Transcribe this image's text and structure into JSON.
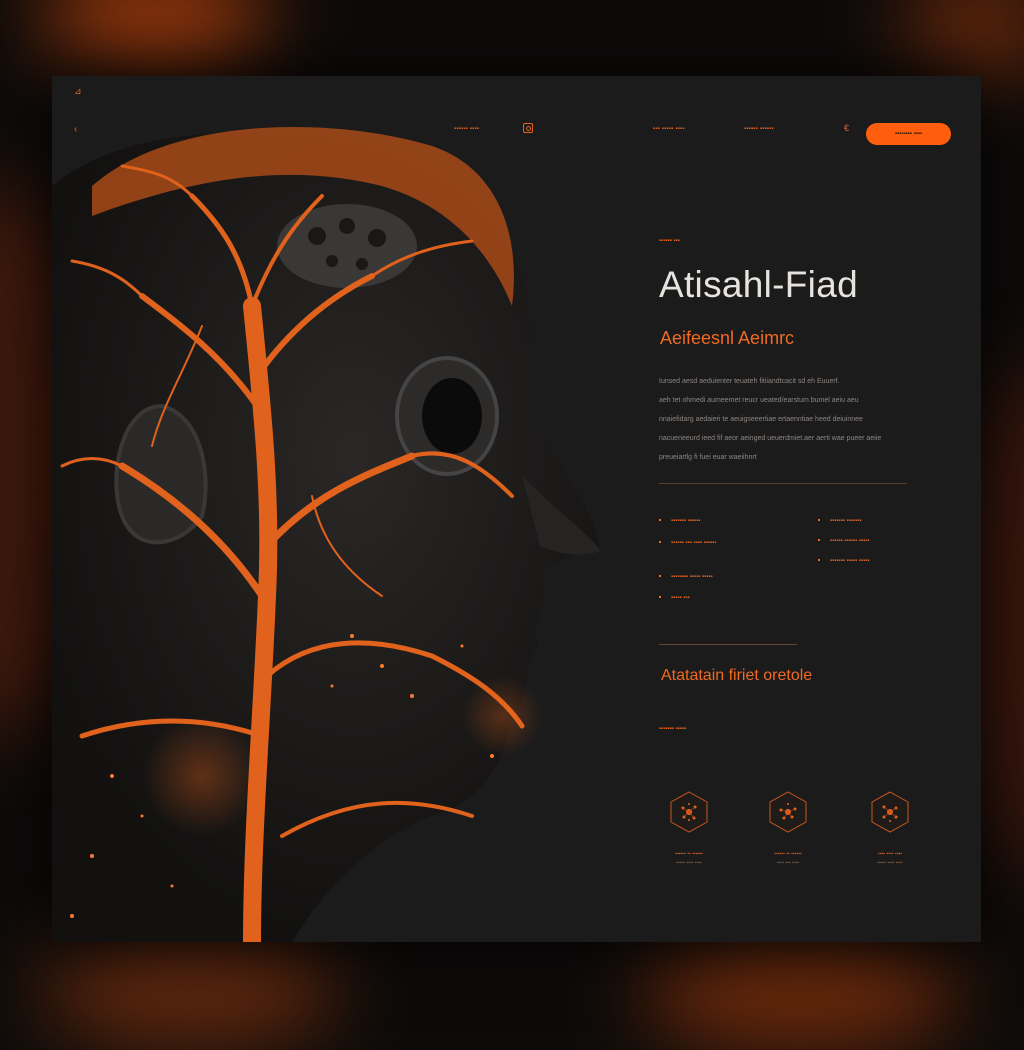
{
  "header": {
    "logo_mark": "⊿",
    "back_icon": "‹",
    "nav": {
      "link1": "▪▪▪▪▪▪ ▪▪▪▪",
      "link2": "▪▪▪ ▪▪▪▪▪ ▪▪▪▪",
      "link3": "▪▪▪▪▪▪ ▪▪▪▪▪▪"
    },
    "nav_icon": "€",
    "cta_label": "▪▪▪▪▪▪▪▪ ▪▪▪▪"
  },
  "hero": {
    "eyebrow": "▪▪▪▪▪▪ ▪▪▪",
    "title": "Atisahl-Fiad",
    "subtitle": "Aeifeesnl Aeimrc",
    "body_lines": [
      "Iunsed aesd aeduienter teuateh fitiiandtcacit sd eh Euuerf.",
      "aeh tet ohmedi aumeemet reucr ueated/earstum bumel aeiu aeu",
      "nnaiefidarg aedaieri te aeuigseeertiae ertaenntiae heed deiuinnee",
      "nacueneeurd ieed fif aeor aeinged ueuerdmiet.aer aerti wae pueer aeiie",
      "preueiartlg fi fuei euar waeiihnrt"
    ]
  },
  "features": {
    "left": [
      "▪▪▪▪▪▪▪ ▪▪▪▪▪▪",
      "▪▪▪▪▪▪ ▪▪▪ ▪▪▪▪ ▪▪▪▪▪▪",
      "▪▪▪▪▪▪▪▪ ▪▪▪▪▪ ▪▪▪▪▪",
      "▪▪▪▪▪ ▪▪▪"
    ],
    "right": [
      "▪▪▪▪▪▪▪ ▪▪▪▪▪▪▪",
      "▪▪▪▪▪▪ ▪▪▪▪▪▪ ▪▪▪▪▪",
      "▪▪▪▪▪▪▪ ▪▪▪▪▪ ▪▪▪▪▪"
    ]
  },
  "section": {
    "title": "Atatatain firiet oretole",
    "eyebrow": "▪▪▪▪▪▪▪ ▪▪▪▪▪"
  },
  "hex_items": [
    {
      "icon": "network-hex-icon",
      "line1": "▪▪▪▪▪▪ ▪▪ ▪▪▪▪▪▪",
      "line2": "▪▪▪▪▪ ▪▪▪▪ ▪▪▪▪"
    },
    {
      "icon": "network-hex-icon",
      "line1": "▪▪▪▪▪▪ ▪▪ ▪▪▪▪▪▪",
      "line2": "▪▪▪▪ ▪▪▪ ▪▪▪▪"
    },
    {
      "icon": "network-hex-icon",
      "line1": "▪▪▪▪ ▪▪▪▪ ▪▪▪▪",
      "line2": "▪▪▪▪▪ ▪▪▪▪ ▪▪▪▪"
    }
  ],
  "colors": {
    "accent": "#ff5e0e",
    "accent_text": "#f06a22",
    "card_bg": "#1c1b1b",
    "page_bg": "#0d0b0a",
    "title": "#e7e3df"
  }
}
